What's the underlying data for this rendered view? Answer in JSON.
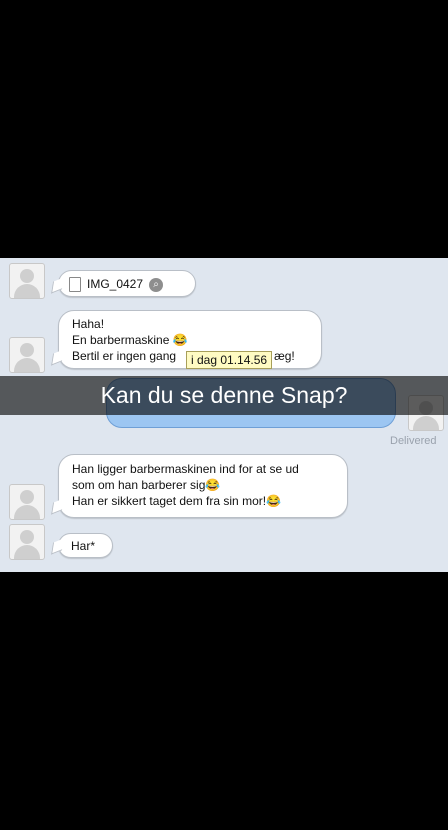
{
  "chat": {
    "attachment": {
      "filename": "IMG_0427",
      "file_icon": "document-icon",
      "action_icon": "magnifier-icon"
    },
    "message1": {
      "lines": [
        "Haha!",
        "En barbermaskine 😂",
        "Bertil er ingen gang",
        "æg!"
      ]
    },
    "tooltip": "i dag 01.14.56",
    "delivered": "Delivered",
    "message2": {
      "lines": [
        "Han ligger barbermaskinen ind for at se ud",
        "som om han barberer sig😂",
        "Han er sikkert taget dem fra sin mor!😂"
      ]
    },
    "message3": {
      "text": "Har*"
    }
  },
  "snap": {
    "caption": "Kan du se denne Snap?"
  },
  "colors": {
    "chat_bg": "#dfe6ef",
    "sent_bubble": "#9cc6f2",
    "overlay": "#000000"
  }
}
